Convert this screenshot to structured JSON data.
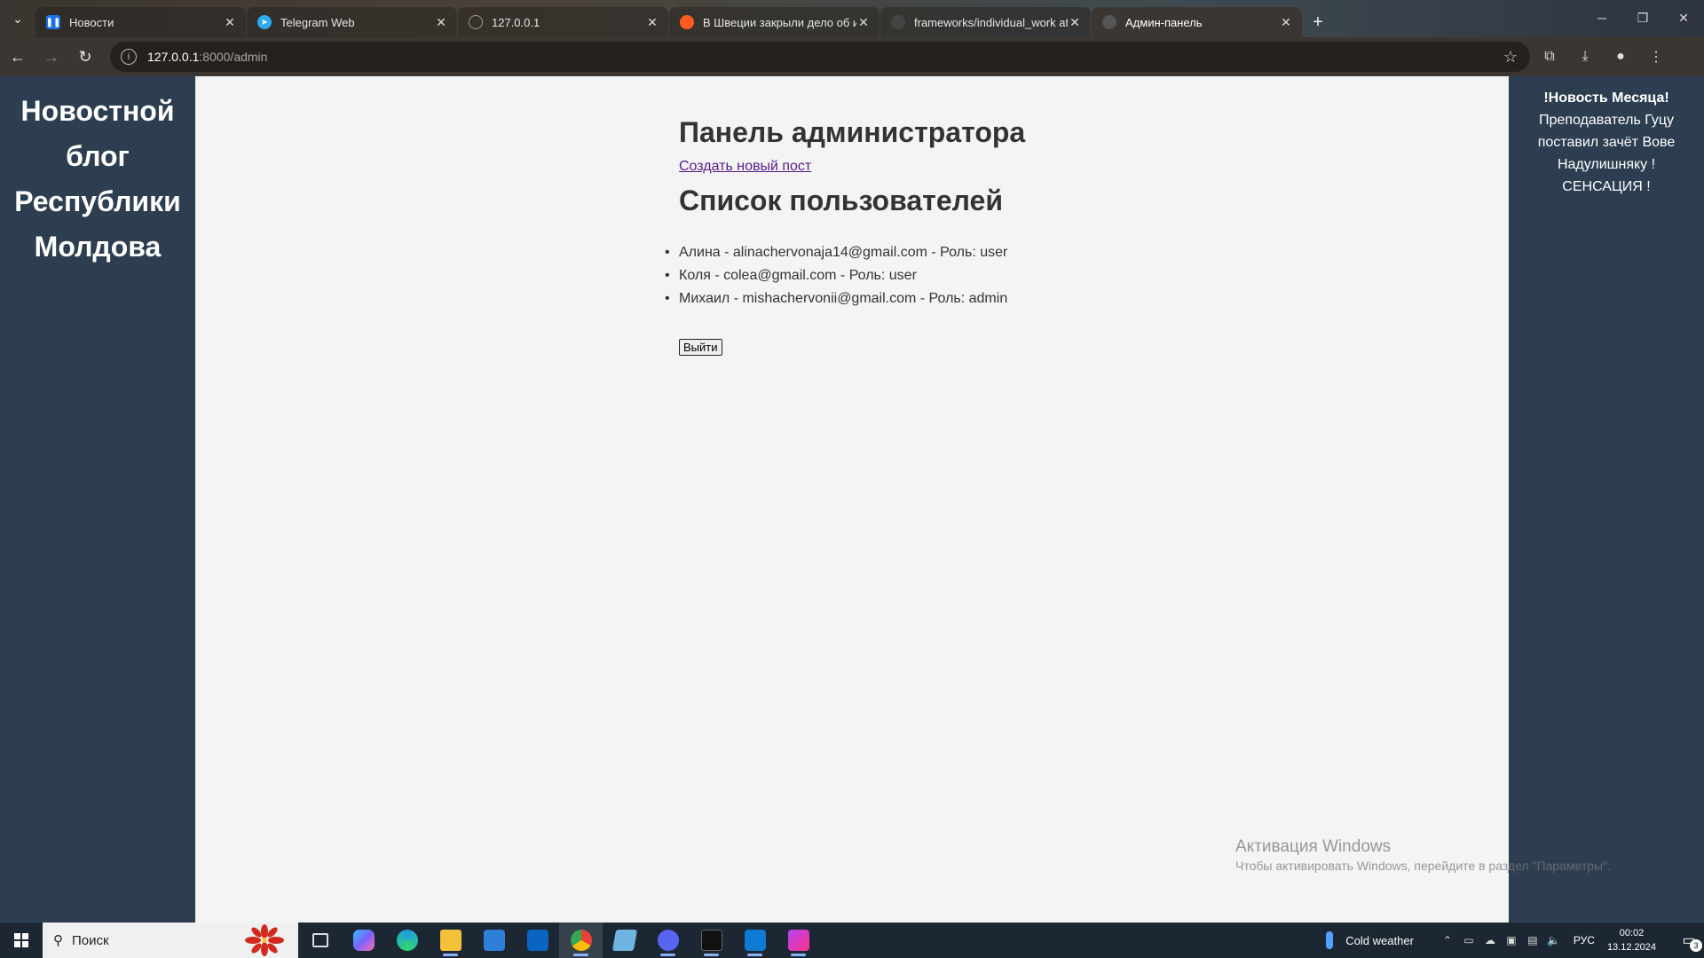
{
  "browser": {
    "tabs": [
      {
        "title": "Новости",
        "icon": "pause-news-icon",
        "color": "#1a73e8",
        "active": false
      },
      {
        "title": "Telegram Web",
        "icon": "telegram-icon",
        "color": "#2aabee",
        "active": false
      },
      {
        "title": "127.0.0.1",
        "icon": "globe-icon",
        "color": "#888888",
        "active": false
      },
      {
        "title": "В Швеции закрыли дело об и",
        "icon": "news-orange-icon",
        "color": "#ff5a1f",
        "active": false
      },
      {
        "title": "frameworks/individual_work at",
        "icon": "github-icon",
        "color": "#444444",
        "active": false
      },
      {
        "title": "Админ-панель",
        "icon": "page-icon",
        "color": "#555555",
        "active": true
      }
    ],
    "url_host": "127.0.0.1",
    "url_path": ":8000/admin"
  },
  "sidebar": {
    "title_lines": [
      "Новостной",
      "блог",
      "Республики",
      "Молдова"
    ]
  },
  "main": {
    "title": "Панель администратора",
    "create_link": "Создать новый пост",
    "users_heading": "Список пользователей",
    "users": [
      "Алина - alinachervonaja14@gmail.com - Роль: user",
      "Коля - colea@gmail.com - Роль: user",
      "Михаил - mishachervonii@gmail.com - Роль: admin"
    ],
    "logout_label": "Выйти"
  },
  "news": {
    "label": "!Новость Месяца!",
    "text": "Преподаватель Гуцу поставил зачёт Вове Надулишняку ! СЕНСАЦИЯ !"
  },
  "activation": {
    "title": "Активация Windows",
    "subtitle": "Чтобы активировать Windows, перейдите в раздел \"Параметры\"."
  },
  "taskbar": {
    "search_placeholder": "Поиск",
    "weather": "Cold weather",
    "lang": "РУС",
    "time": "00:02",
    "date": "13.12.2024",
    "notifications": "3",
    "apps": [
      {
        "name": "task-view-icon",
        "color": "#2b2b2b"
      },
      {
        "name": "copilot-icon",
        "color": "#7b61ff"
      },
      {
        "name": "edge-icon",
        "color": "#1e9de0"
      },
      {
        "name": "file-explorer-icon",
        "color": "#f3c13a"
      },
      {
        "name": "store-icon",
        "color": "#2f7fd8"
      },
      {
        "name": "outlook-icon",
        "color": "#0a64c2"
      },
      {
        "name": "chrome-icon",
        "color": "#34a853"
      },
      {
        "name": "notepad-icon",
        "color": "#6fb3e0"
      },
      {
        "name": "discord-icon",
        "color": "#5865f2"
      },
      {
        "name": "terminal-icon",
        "color": "#111111"
      },
      {
        "name": "vscode-icon",
        "color": "#0e7ad3"
      },
      {
        "name": "phpstorm-icon",
        "color": "#b345f1"
      }
    ]
  }
}
